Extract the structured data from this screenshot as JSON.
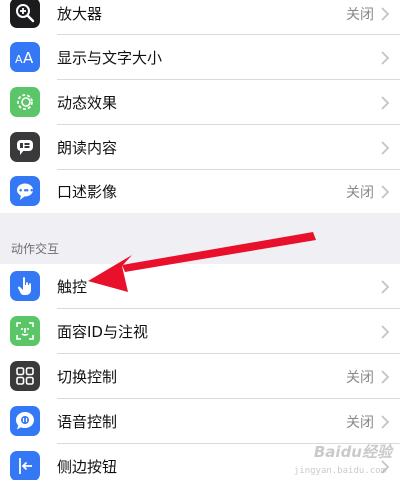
{
  "section1": {
    "items": [
      {
        "label": "放大器",
        "value": "关闭",
        "icon": "magnifier-icon",
        "color": "#1c1c1e"
      },
      {
        "label": "显示与文字大小",
        "value": "",
        "icon": "text-size-icon",
        "color": "#3478f6"
      },
      {
        "label": "动态效果",
        "value": "",
        "icon": "motion-icon",
        "color": "#5ac668"
      },
      {
        "label": "朗读内容",
        "value": "",
        "icon": "speech-icon",
        "color": "#3a3a3c"
      },
      {
        "label": "口述影像",
        "value": "关闭",
        "icon": "audio-description-icon",
        "color": "#3478f6"
      }
    ]
  },
  "section2": {
    "header": "动作交互",
    "items": [
      {
        "label": "触控",
        "value": "",
        "icon": "hand-touch-icon",
        "color": "#3478f6"
      },
      {
        "label": "面容ID与注视",
        "value": "",
        "icon": "face-id-icon",
        "color": "#5ac668"
      },
      {
        "label": "切换控制",
        "value": "关闭",
        "icon": "switch-control-icon",
        "color": "#3a3a3c"
      },
      {
        "label": "语音控制",
        "value": "关闭",
        "icon": "voice-control-icon",
        "color": "#3478f6"
      },
      {
        "label": "侧边按钮",
        "value": "",
        "icon": "side-button-icon",
        "color": "#3478f6"
      }
    ]
  },
  "watermark": {
    "text": "Baidu经验",
    "sub": "jingyan.baidu.com"
  },
  "colors": {
    "arrow": "#e8102a",
    "background": "#efeff4"
  }
}
